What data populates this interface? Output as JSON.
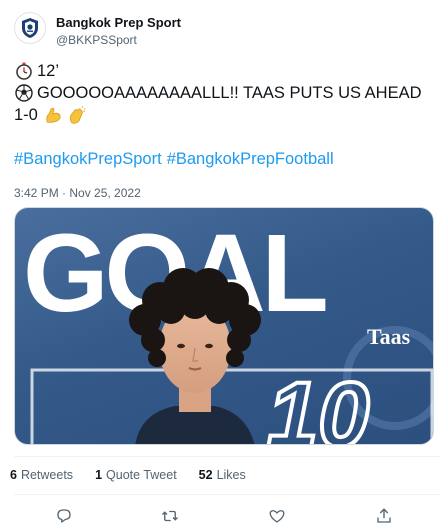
{
  "account": {
    "display_name": "Bangkok Prep Sport",
    "handle": "@BKKPSSport"
  },
  "tweet": {
    "line1": "12’",
    "line1_icon": "stopwatch-emoji",
    "line2": "GOOOOOAAAAAAAALLL!! TAAS PUTS US AHEAD",
    "line2_icon": "soccer-ball-emoji",
    "line3": "1-0",
    "line3_icons": [
      "flexed-biceps-emoji",
      "clapping-hands-emoji"
    ],
    "hashtags": [
      "#BangkokPrepSport",
      "#BangkokPrepFootball"
    ],
    "timestamp": "3:42 PM · Nov 25, 2022"
  },
  "media": {
    "headline": "GOAL",
    "player_name": "Taas",
    "shirt_number": "10",
    "colors": {
      "background": "#345a8a",
      "headline": "#ffffff"
    }
  },
  "stats": {
    "retweets_count": "6",
    "retweets_label": "Retweets",
    "quotes_count": "1",
    "quotes_label": "Quote Tweet",
    "likes_count": "52",
    "likes_label": "Likes"
  },
  "actions": {
    "icons": [
      "reply-icon",
      "retweet-icon",
      "like-icon",
      "share-icon"
    ]
  },
  "colors": {
    "link": "#1d9bf0",
    "secondary_text": "#536471",
    "primary_text": "#0f1419"
  }
}
